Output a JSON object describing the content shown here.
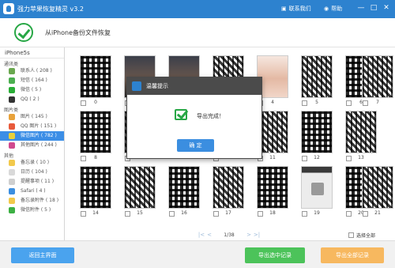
{
  "window": {
    "title": "强力苹果恢复精灵 v3.2",
    "contact_label": "联系我们",
    "help_label": "帮助"
  },
  "header": {
    "heading": "从iPhone备份文件恢复"
  },
  "sidebar": {
    "device": "iPhone5s",
    "groups": [
      {
        "label": "通讯类",
        "items": [
          {
            "label": "联系人 ( 208 )",
            "icon": "contacts-icon",
            "color": "#6aa84f"
          },
          {
            "label": "短信 ( 164 )",
            "icon": "sms-icon",
            "color": "#4caf50"
          },
          {
            "label": "微信 ( 5 )",
            "icon": "wechat-icon",
            "color": "#2aae37"
          },
          {
            "label": "QQ ( 2 )",
            "icon": "qq-icon",
            "color": "#333333"
          }
        ]
      },
      {
        "label": "图片类",
        "items": [
          {
            "label": "图片 ( 145 )",
            "icon": "photos-icon",
            "color": "#e8a23b"
          },
          {
            "label": "QQ 图片 ( 151 )",
            "icon": "qq-photos-icon",
            "color": "#e85a3b"
          },
          {
            "label": "微信图片 ( 782 )",
            "icon": "wechat-photos-icon",
            "color": "#e8d03b",
            "selected": true
          },
          {
            "label": "其他图片 ( 244 )",
            "icon": "other-photos-icon",
            "color": "#d04a8e"
          }
        ]
      },
      {
        "label": "其他",
        "items": [
          {
            "label": "备忘录 ( 10 )",
            "icon": "notes-icon",
            "color": "#f2c94c"
          },
          {
            "label": "日历 ( 104 )",
            "icon": "calendar-icon",
            "color": "#d9d9d9"
          },
          {
            "label": "提醒事项 ( 11 )",
            "icon": "reminders-icon",
            "color": "#cfcfcf"
          },
          {
            "label": "Safari ( 4 )",
            "icon": "safari-icon",
            "color": "#3b8ee0"
          },
          {
            "label": "备忘录附件 ( 18 )",
            "icon": "notes-attachment-icon",
            "color": "#f2c94c"
          },
          {
            "label": "微信附件 ( 5 )",
            "icon": "wechat-attachment-icon",
            "color": "#3cb043"
          }
        ]
      }
    ]
  },
  "grid": {
    "rows": [
      {
        "labels": [
          "0",
          "1",
          "2",
          "3",
          "4",
          "5",
          "6",
          "7"
        ],
        "kinds": [
          "qr",
          "photo",
          "photo",
          "qr",
          "girl",
          "qr",
          "qr",
          "qr"
        ]
      },
      {
        "labels": [
          "8",
          "9",
          "10",
          "11",
          "12",
          "13"
        ],
        "kinds": [
          "qr",
          "qr",
          "qr",
          "qr",
          "qr",
          "qr"
        ]
      },
      {
        "labels": [
          "14",
          "15",
          "16",
          "17",
          "18",
          "19",
          "20",
          "21"
        ],
        "kinds": [
          "qr",
          "qr",
          "qr",
          "qr",
          "qr",
          "chat",
          "qr",
          "qr"
        ]
      }
    ]
  },
  "pager": {
    "first": "|<",
    "prev": "<",
    "page": "1/38",
    "next": ">",
    "last": ">|",
    "select_all": "选择全部"
  },
  "buttons": {
    "back": "返回主界面",
    "export_selected": "导出选中记录",
    "export_all": "导出全部记录"
  },
  "dialog": {
    "title": "温馨提示",
    "message": "导出完成！",
    "ok": "确 定"
  }
}
